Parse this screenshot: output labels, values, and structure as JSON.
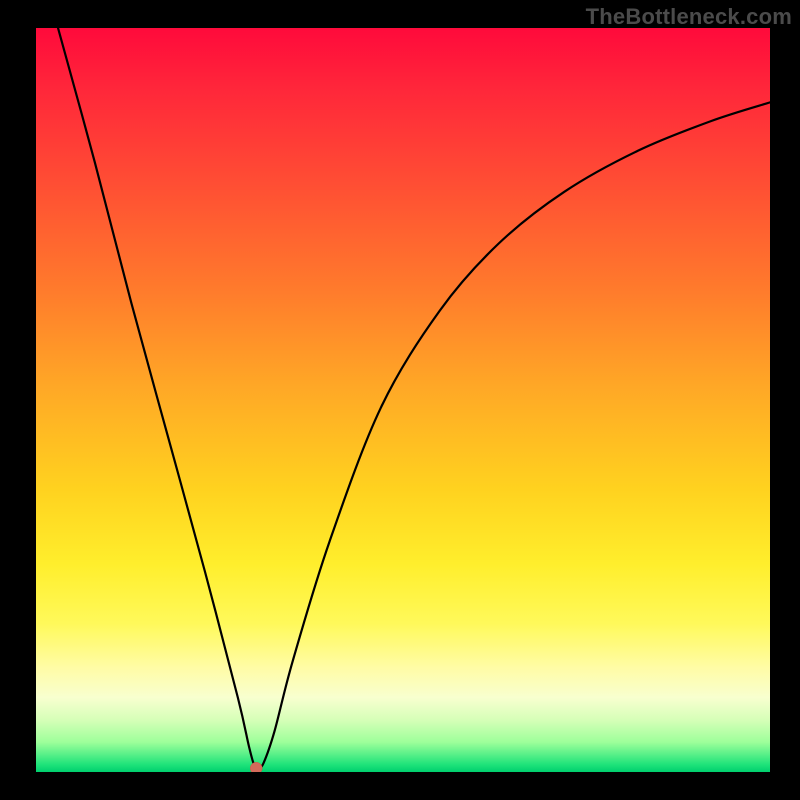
{
  "watermark": {
    "text": "TheBottleneck.com"
  },
  "colors": {
    "frame_bg": "#000000",
    "watermark_text": "#4b4b4b",
    "curve_stroke": "#000000",
    "min_marker": "#d46a5a",
    "gradient_stops": [
      "#ff0a3b",
      "#ff263a",
      "#ff4b34",
      "#ff7a2c",
      "#ffa726",
      "#ffd21f",
      "#ffee2c",
      "#fff95a",
      "#fffca6",
      "#f8ffcf",
      "#d6ffb8",
      "#9dff9a",
      "#1fe37a",
      "#00cf6e"
    ]
  },
  "chart_data": {
    "type": "line",
    "title": "",
    "xlabel": "",
    "ylabel": "",
    "xlim": [
      0,
      100
    ],
    "ylim": [
      0,
      100
    ],
    "grid": false,
    "series": [
      {
        "name": "bottleneck-curve",
        "x": [
          3,
          8,
          13,
          18,
          23,
          27.5,
          29,
          29.7,
          30.3,
          31,
          32.5,
          35,
          40,
          47,
          55,
          63,
          72,
          82,
          92,
          100
        ],
        "y": [
          100,
          82,
          63,
          45,
          27,
          10,
          3.5,
          1.0,
          0.6,
          1.2,
          5.5,
          15,
          31,
          49,
          62,
          71,
          78,
          83.5,
          87.5,
          90
        ]
      }
    ],
    "annotations": [
      {
        "name": "min-point",
        "x": 30,
        "y": 0.5
      }
    ],
    "background": "vertical-gradient-red-to-green"
  }
}
